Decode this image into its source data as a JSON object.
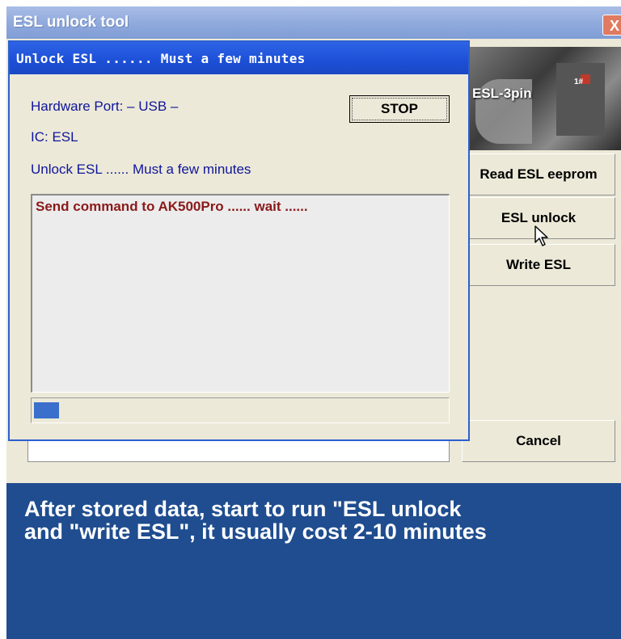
{
  "outer_window": {
    "title": "ESL unlock tool",
    "close_label": "X",
    "image_label": "ESL-3pin",
    "image_tag": "1#",
    "buttons": {
      "read_eeprom": "Read ESL eeprom",
      "esl_unlock": "ESL unlock",
      "write_esl": "Write ESL",
      "cancel": "Cancel"
    }
  },
  "dialog": {
    "title": "Unlock ESL ...... Must a few minutes",
    "hardware_port": "Hardware Port: – USB –",
    "ic": "IC: ESL",
    "status": "Unlock ESL ...... Must a few minutes",
    "stop_label": "STOP",
    "log_lines": [
      "Send command to AK500Pro ...... wait ......"
    ],
    "progress_fraction": 0.06
  },
  "caption": {
    "line1": "After stored data, start to run \"ESL unlock",
    "line2": "and \"write ESL\", it usually cost 2-10 minutes"
  },
  "colors": {
    "dialog_title_bg": "#1c4fd6",
    "label_text": "#10159c",
    "log_text": "#8b1a1a",
    "progress_fill": "#3a6fcc",
    "caption_bg": "#1f4d8f"
  },
  "icons": {
    "close": "close-icon",
    "cursor": "mouse-pointer-icon"
  }
}
